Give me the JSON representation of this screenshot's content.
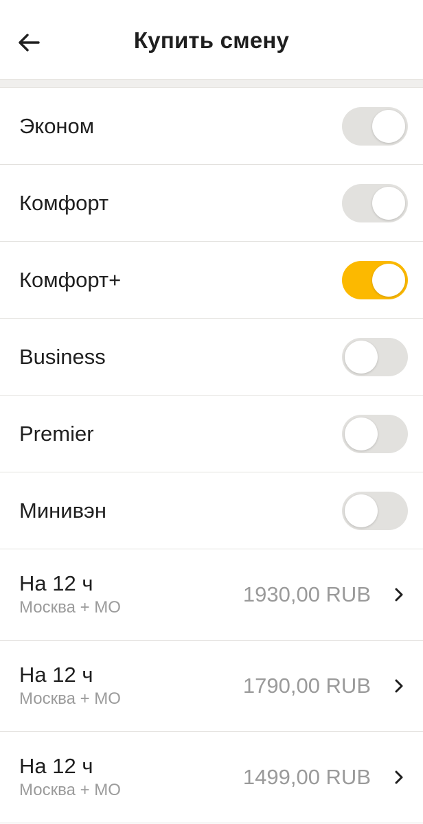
{
  "header": {
    "title": "Купить смену",
    "back_icon": "arrow-left-icon"
  },
  "tariffs": [
    {
      "label": "Эконом",
      "state": "on-disabled"
    },
    {
      "label": "Комфорт",
      "state": "on-disabled"
    },
    {
      "label": "Комфорт+",
      "state": "on"
    },
    {
      "label": "Business",
      "state": "off"
    },
    {
      "label": "Premier",
      "state": "off"
    },
    {
      "label": "Минивэн",
      "state": "off"
    }
  ],
  "offers": [
    {
      "title": "На 12 ч",
      "region": "Москва + МО",
      "price": "1930,00 RUB"
    },
    {
      "title": "На 12 ч",
      "region": "Москва + МО",
      "price": "1790,00 RUB"
    },
    {
      "title": "На 12 ч",
      "region": "Москва + МО",
      "price": "1499,00 RUB"
    }
  ],
  "colors": {
    "accent": "#fcb900",
    "toggle_off": "#e2e1de",
    "secondary_text": "#9b9b9b"
  }
}
